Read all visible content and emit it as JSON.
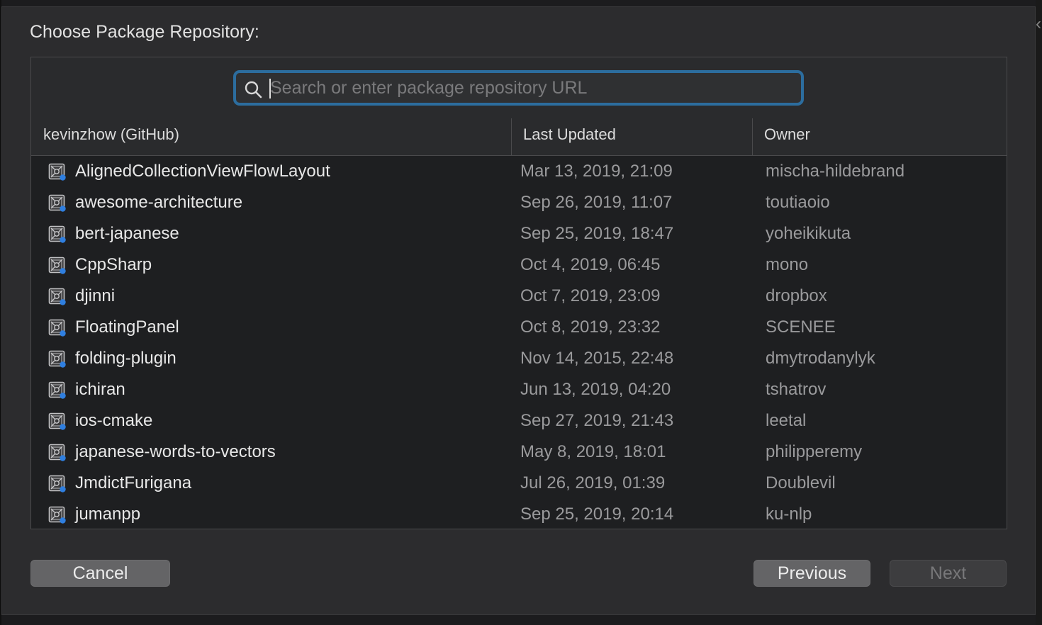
{
  "dialog": {
    "title": "Choose Package Repository:"
  },
  "search": {
    "placeholder": "Search or enter package repository URL",
    "value": ""
  },
  "columns": {
    "name": "kevinzhow (GitHub)",
    "updated": "Last Updated",
    "owner": "Owner"
  },
  "repos": [
    {
      "name": "AlignedCollectionViewFlowLayout",
      "updated": "Mar 13, 2019, 21:09",
      "owner": "mischa-hildebrand"
    },
    {
      "name": "awesome-architecture",
      "updated": "Sep 26, 2019, 11:07",
      "owner": "toutiaoio"
    },
    {
      "name": "bert-japanese",
      "updated": "Sep 25, 2019, 18:47",
      "owner": "yoheikikuta"
    },
    {
      "name": "CppSharp",
      "updated": "Oct 4, 2019, 06:45",
      "owner": "mono"
    },
    {
      "name": "djinni",
      "updated": "Oct 7, 2019, 23:09",
      "owner": "dropbox"
    },
    {
      "name": "FloatingPanel",
      "updated": "Oct 8, 2019, 23:32",
      "owner": "SCENEE"
    },
    {
      "name": "folding-plugin",
      "updated": "Nov 14, 2015, 22:48",
      "owner": "dmytrodanylyk"
    },
    {
      "name": "ichiran",
      "updated": "Jun 13, 2019, 04:20",
      "owner": "tshatrov"
    },
    {
      "name": "ios-cmake",
      "updated": "Sep 27, 2019, 21:43",
      "owner": "leetal"
    },
    {
      "name": "japanese-words-to-vectors",
      "updated": "May 8, 2019, 18:01",
      "owner": "philipperemy"
    },
    {
      "name": "JmdictFurigana",
      "updated": "Jul 26, 2019, 01:39",
      "owner": "Doublevil"
    },
    {
      "name": "jumanpp",
      "updated": "Sep 25, 2019, 20:14",
      "owner": "ku-nlp"
    }
  ],
  "buttons": {
    "cancel": "Cancel",
    "previous": "Previous",
    "next": "Next"
  },
  "icons": {
    "search": "magnifying-glass-icon",
    "repo": "repository-icon",
    "window_edge": "chevron-left-icon"
  },
  "colors": {
    "focus_ring": "#2c6d9e",
    "repo_icon_accent": "#2f7fe0"
  }
}
